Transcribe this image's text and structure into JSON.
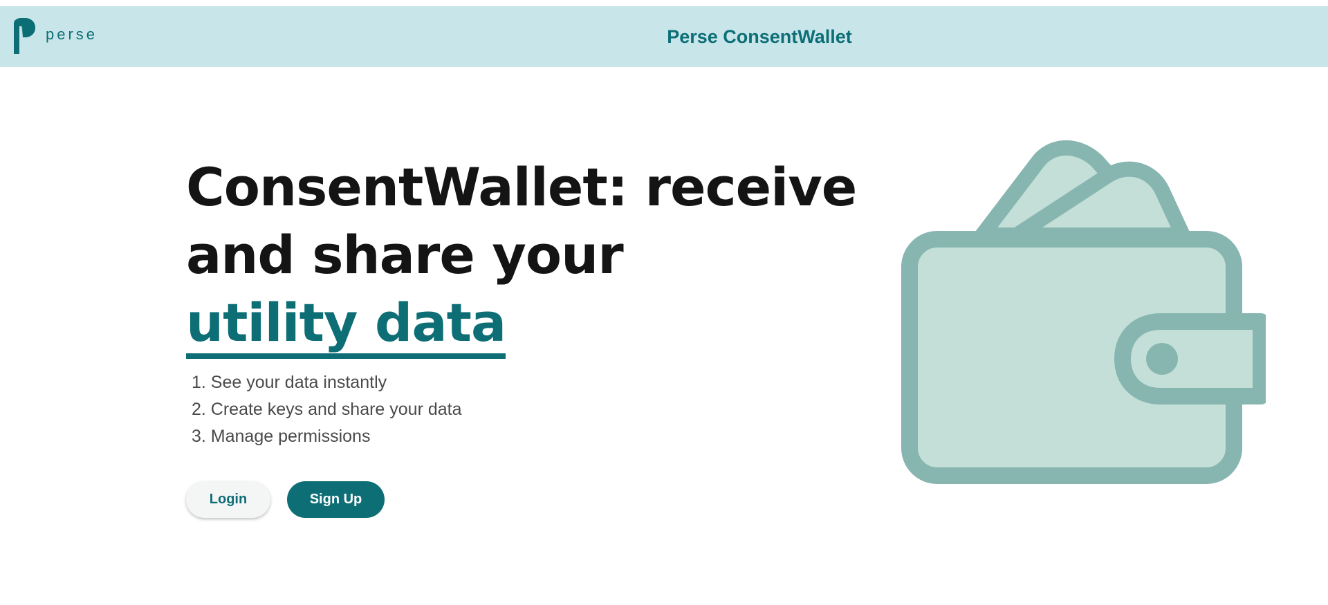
{
  "header": {
    "logo_text": "perse",
    "title": "Perse ConsentWallet"
  },
  "hero": {
    "title_line1": "ConsentWallet: receive",
    "title_line2": "and share your",
    "title_highlight": "utility data",
    "steps": [
      "1. See your data instantly",
      "2. Create keys and share your data",
      "3. Manage permissions"
    ]
  },
  "actions": {
    "login_label": "Login",
    "signup_label": "Sign Up"
  },
  "colors": {
    "brand": "#0d6e76",
    "header_bg": "#c8e6ea",
    "wallet_stroke": "#87b5b0",
    "wallet_fill": "#c3dfd7"
  },
  "illustration": {
    "icon": "wallet-icon"
  }
}
